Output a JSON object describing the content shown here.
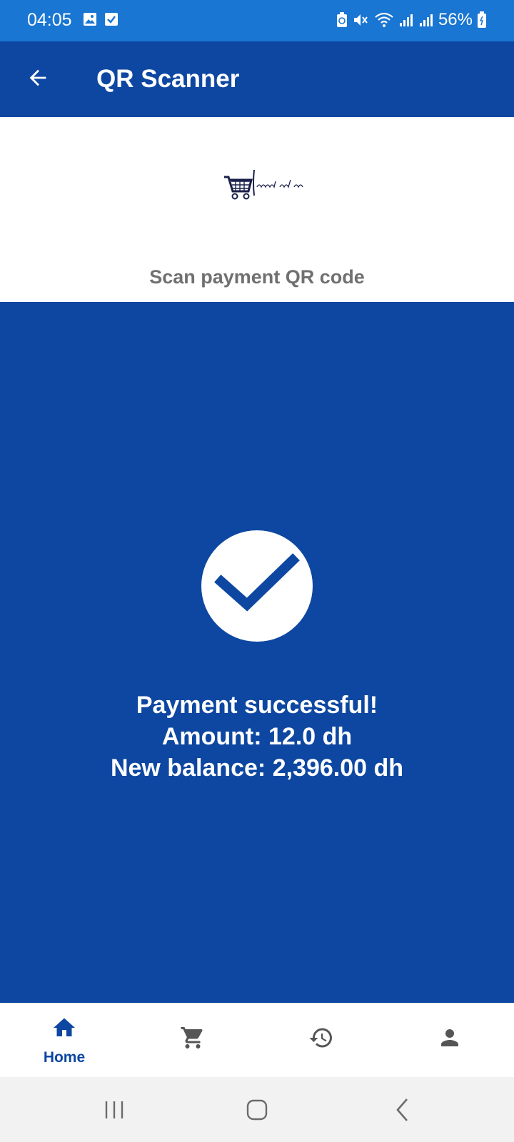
{
  "status_bar": {
    "time": "04:05",
    "battery": "56%",
    "icons": [
      "image-icon",
      "check-box-icon",
      "battery-saver-icon",
      "mute-icon",
      "wifi-icon",
      "signal-icon",
      "signal-icon",
      "battery-icon"
    ]
  },
  "app_bar": {
    "title": "QR Scanner",
    "back_icon": "arrow-back-icon"
  },
  "logo": {
    "text": "smart cart"
  },
  "scan_label": "Scan payment QR code",
  "result": {
    "line1": "Payment successful!",
    "line2": "Amount: 12.0 dh",
    "line3": "New balance: 2,396.00 dh"
  },
  "bottom_nav": {
    "items": [
      {
        "label": "Home",
        "icon": "home-icon",
        "active": true
      },
      {
        "label": "",
        "icon": "cart-icon",
        "active": false
      },
      {
        "label": "",
        "icon": "history-icon",
        "active": false
      },
      {
        "label": "",
        "icon": "person-icon",
        "active": false
      }
    ]
  },
  "colors": {
    "primary": "#0d47a1",
    "status_bar": "#1976d2",
    "inactive_icon": "#555555",
    "label_gray": "#707070"
  }
}
